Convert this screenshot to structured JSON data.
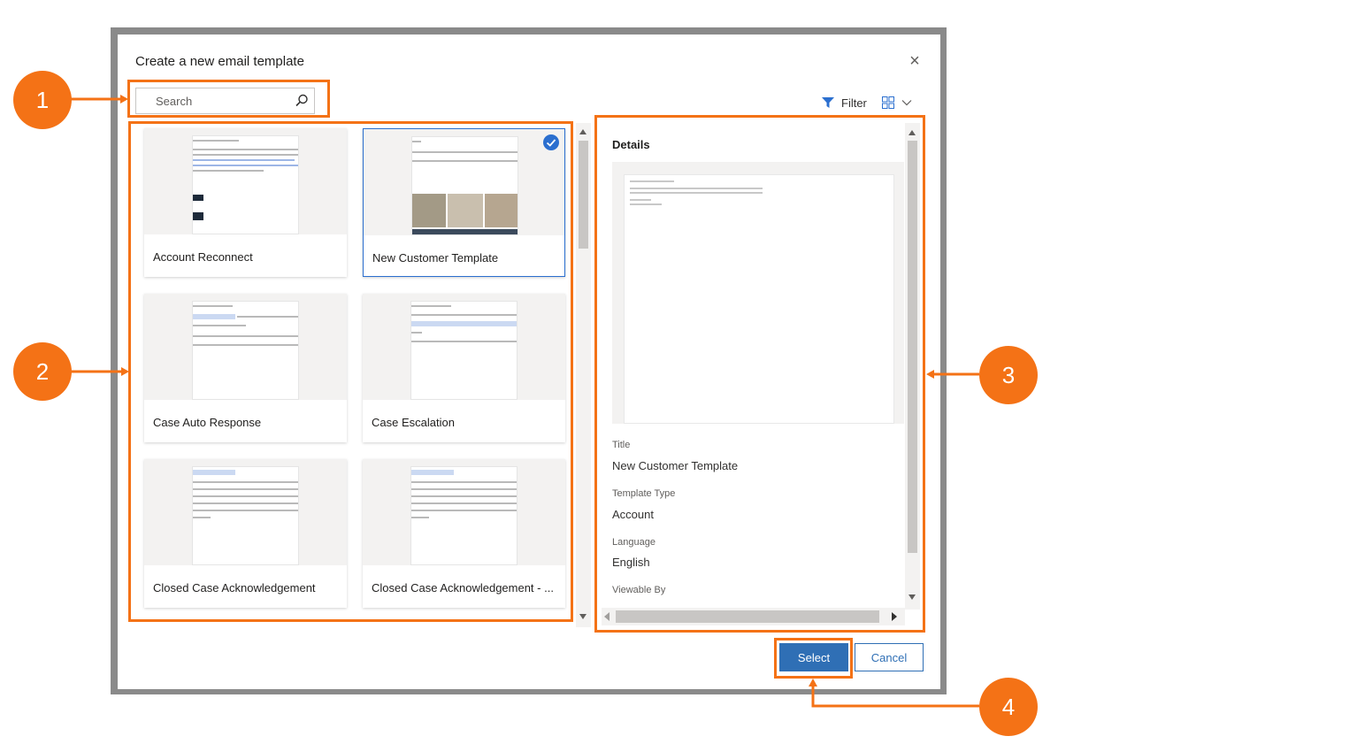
{
  "dialog": {
    "title": "Create a new email template",
    "close_glyph": "×"
  },
  "toolbar": {
    "search_placeholder": "Search",
    "filter_label": "Filter"
  },
  "templates": [
    {
      "name": "Account Reconnect",
      "selected": false
    },
    {
      "name": "New Customer Template",
      "selected": true
    },
    {
      "name": "Case Auto Response",
      "selected": false
    },
    {
      "name": "Case Escalation",
      "selected": false
    },
    {
      "name": "Closed Case Acknowledgement",
      "selected": false
    },
    {
      "name": "Closed Case Acknowledgement - ...",
      "selected": false
    }
  ],
  "details": {
    "heading": "Details",
    "fields": [
      {
        "label": "Title",
        "value": "New Customer Template"
      },
      {
        "label": "Template Type",
        "value": "Account"
      },
      {
        "label": "Language",
        "value": "English"
      },
      {
        "label": "Viewable By",
        "value": ""
      }
    ]
  },
  "buttons": {
    "select": "Select",
    "cancel": "Cancel"
  },
  "callouts": [
    "1",
    "2",
    "3",
    "4"
  ],
  "colors": {
    "accent": "#f47216",
    "primary_button": "#2f6fb5",
    "selection_border": "#2b6fcf"
  },
  "icons": [
    "search-icon",
    "filter-icon",
    "grid-view-icon",
    "chevron-down-icon",
    "close-icon",
    "checkmark-icon"
  ]
}
